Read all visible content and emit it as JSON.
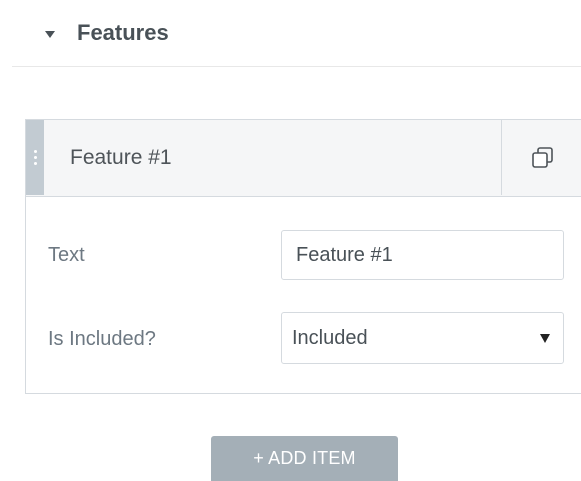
{
  "section": {
    "title": "Features"
  },
  "repeater": {
    "item": {
      "title": "Feature #1"
    },
    "controls": {
      "text": {
        "label": "Text",
        "value": "Feature #1"
      },
      "included": {
        "label": "Is Included?",
        "value": "Included"
      }
    },
    "add_label": "+ ADD ITEM"
  },
  "icons": {
    "section_toggle": "caret-down-icon",
    "duplicate": "duplicate-icon",
    "drag": "drag-handle-icon",
    "select": "select-arrow-icon"
  },
  "colors": {
    "header_bg": "#f5f6f7",
    "border": "#d5dadf",
    "drag_handle": "#c2cbd2",
    "add_button": "#a4afb7",
    "title_text": "#495157"
  }
}
